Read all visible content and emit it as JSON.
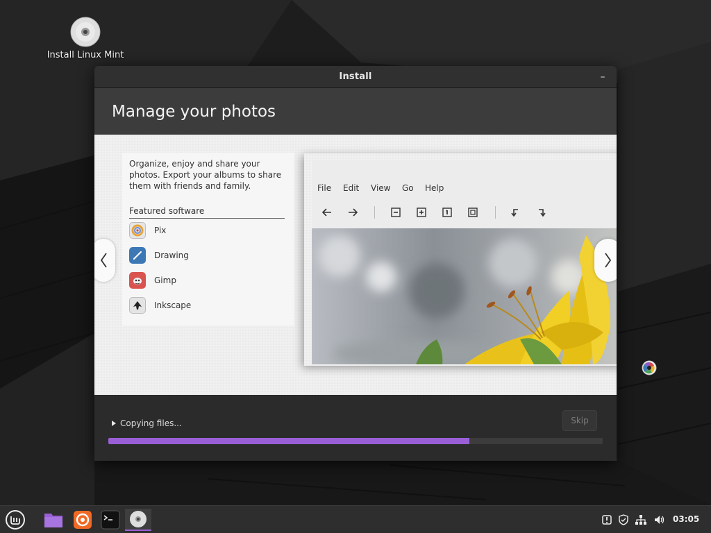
{
  "desktop": {
    "icon_label": "Install Linux Mint"
  },
  "window": {
    "title": "Install",
    "minimize_glyph": "–"
  },
  "slide": {
    "heading": "Manage your photos",
    "description": "Organize, enjoy and share your photos. Export your albums to share them with friends and family.",
    "featured_label": "Featured software",
    "apps": [
      {
        "name": "Pix",
        "icon": "pix-icon"
      },
      {
        "name": "Drawing",
        "icon": "drawing-icon"
      },
      {
        "name": "Gimp",
        "icon": "gimp-icon"
      },
      {
        "name": "Inkscape",
        "icon": "inkscape-icon"
      }
    ],
    "preview_menu": [
      "File",
      "Edit",
      "View",
      "Go",
      "Help"
    ]
  },
  "footer": {
    "status_text": "Copying files...",
    "skip_label": "Skip",
    "progress_percent": 73
  },
  "taskbar": {
    "clock": "03:05"
  },
  "colors": {
    "accent": "#9a5fd6",
    "window_bg": "#2b2b2b",
    "header_bg": "#3c3c3c",
    "taskbar_bg": "#2e2e2e"
  }
}
